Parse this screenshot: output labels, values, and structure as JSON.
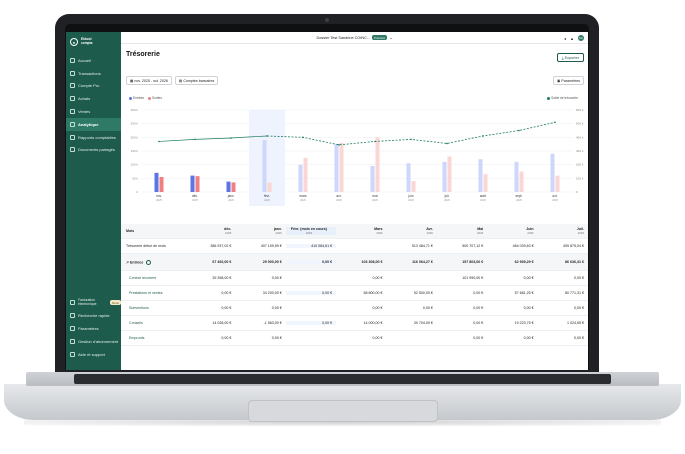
{
  "sidebar": {
    "logo_line1": "Ekkool",
    "logo_line2": "compta",
    "items": [
      {
        "label": "Accueil"
      },
      {
        "label": "Transactions"
      },
      {
        "label": "Compte Pro"
      },
      {
        "label": "Achats"
      },
      {
        "label": "Ventes"
      },
      {
        "label": "Analytique"
      },
      {
        "label": "Rapports comptables"
      },
      {
        "label": "Documents partagés"
      }
    ],
    "bottom_items": [
      {
        "label": "Facturation électronique",
        "badge": "Nouv"
      },
      {
        "label": "Recherche rapide"
      },
      {
        "label": "Paramètres"
      },
      {
        "label": "Gestion d'abonnement"
      },
      {
        "label": "Aide et support"
      }
    ]
  },
  "topbar": {
    "company": "Dossier Test Sandrine COINC...",
    "plan_badge": "Premium",
    "avatar_initials": "SC"
  },
  "page": {
    "title": "Trésorerie",
    "export_label": "Exporter",
    "date_filter": "nov. 2025 - oct. 2026",
    "accounts_filter": "Comptes bancaires",
    "params_label": "Paramètres"
  },
  "legend": {
    "entrees": "Entrées",
    "sorties": "Sorties",
    "solde": "Solde de trésorerie"
  },
  "colors": {
    "sidebar": "#1d5b4c",
    "accent": "#2e7a66",
    "entrees_real": "#5b74e6",
    "entrees_forecast": "#cdd6fb",
    "sorties_real": "#f07f7f",
    "sorties_forecast": "#fad7d4",
    "solde_line": "#1d7a5c"
  },
  "chart_data": {
    "type": "bar",
    "categories": [
      "nov.",
      "déc.",
      "janv.",
      "févr.",
      "mars",
      "avr.",
      "mai",
      "juin",
      "juil.",
      "août",
      "sept.",
      "oct."
    ],
    "years": [
      "2025",
      "2025",
      "2026",
      "2026",
      "2026",
      "2026",
      "2026",
      "2026",
      "2026",
      "2026",
      "2026",
      "2026"
    ],
    "y_ticks": [
      "0",
      "50 k",
      "100 k",
      "150 k",
      "200 k",
      "250 k",
      "300 k"
    ],
    "y2_ticks": [
      "0",
      "100 k",
      "200 k",
      "300 k",
      "400 k",
      "500 k",
      "600 k"
    ],
    "ylim": [
      0,
      300
    ],
    "y2lim": [
      0,
      600
    ],
    "series": [
      {
        "name": "Entrées",
        "values": [
          70,
          60,
          38,
          190,
          100,
          175,
          95,
          105,
          110,
          120,
          110,
          140
        ]
      },
      {
        "name": "Sorties",
        "values": [
          55,
          58,
          35,
          35,
          125,
          180,
          200,
          40,
          130,
          65,
          75,
          60
        ]
      },
      {
        "name": "Solde de trésorerie",
        "axis": "y2",
        "values": [
          370,
          385,
          395,
          410,
          400,
          345,
          370,
          385,
          355,
          410,
          450,
          510
        ]
      }
    ],
    "grid": true,
    "legend": "top"
  },
  "table": {
    "header_label": "Mois",
    "months": [
      {
        "label": "déc.",
        "year": "2025"
      },
      {
        "label": "janv.",
        "year": "2026"
      },
      {
        "label": "Févr. (mois en cours)",
        "year": "2026"
      },
      {
        "label": "Mars",
        "year": "2026"
      },
      {
        "label": "Avr.",
        "year": "2026"
      },
      {
        "label": "Mai",
        "year": "2026"
      },
      {
        "label": "Juin",
        "year": "2026"
      },
      {
        "label": "Juil.",
        "year": "2026"
      }
    ],
    "rows": [
      {
        "label": "Trésorerie début de mois",
        "values": [
          "386 937,02 €",
          "407 159,59 €",
          "410 084,61 €",
          "",
          "513 484,71 €",
          "500 707,12 €",
          "464 039,63 €",
          "495 879,04 €"
        ]
      },
      {
        "label": "Entrées",
        "values": [
          "67 492,00 €",
          "29 000,00 €",
          "0,00 €",
          "103 308,00 €",
          "116 064,27 €",
          "157 803,00 €",
          "62 939,29 €",
          "86 636,31 €"
        ]
      },
      {
        "label": "Contrat récurrent",
        "values": [
          "39 398,00 €",
          "0,00 €",
          "",
          "0,00 €",
          "",
          "101 990,00 €",
          "0,00 €",
          "0,00 €"
        ]
      },
      {
        "label": "Prestations et ventes",
        "values": [
          "0,00 €",
          "34 200,00 €",
          "0,00 €",
          "58 800,00 €",
          "52 500,00 €",
          "0,00 €",
          "57 681,25 €",
          "80 771,31 €"
        ]
      },
      {
        "label": "Subventions",
        "values": [
          "0,00 €",
          "0,00 €",
          "",
          "0,00 €",
          "0,00 €",
          "0,00 €",
          "0,00 €",
          "0,00 €"
        ]
      },
      {
        "label": "Conseils",
        "values": [
          "14 028,00 €",
          "-1 563,00 €",
          "0,00 €",
          "14 000,00 €",
          "30 704,00 €",
          "0,00 €",
          "19 223,75 €",
          "1 024,65 €"
        ]
      },
      {
        "label": "Emprunts",
        "values": [
          "0,00 €",
          "0,00 €",
          "",
          "0,00 €",
          "",
          "0,00 €",
          "0,00 €",
          "0,00 €"
        ]
      }
    ]
  }
}
